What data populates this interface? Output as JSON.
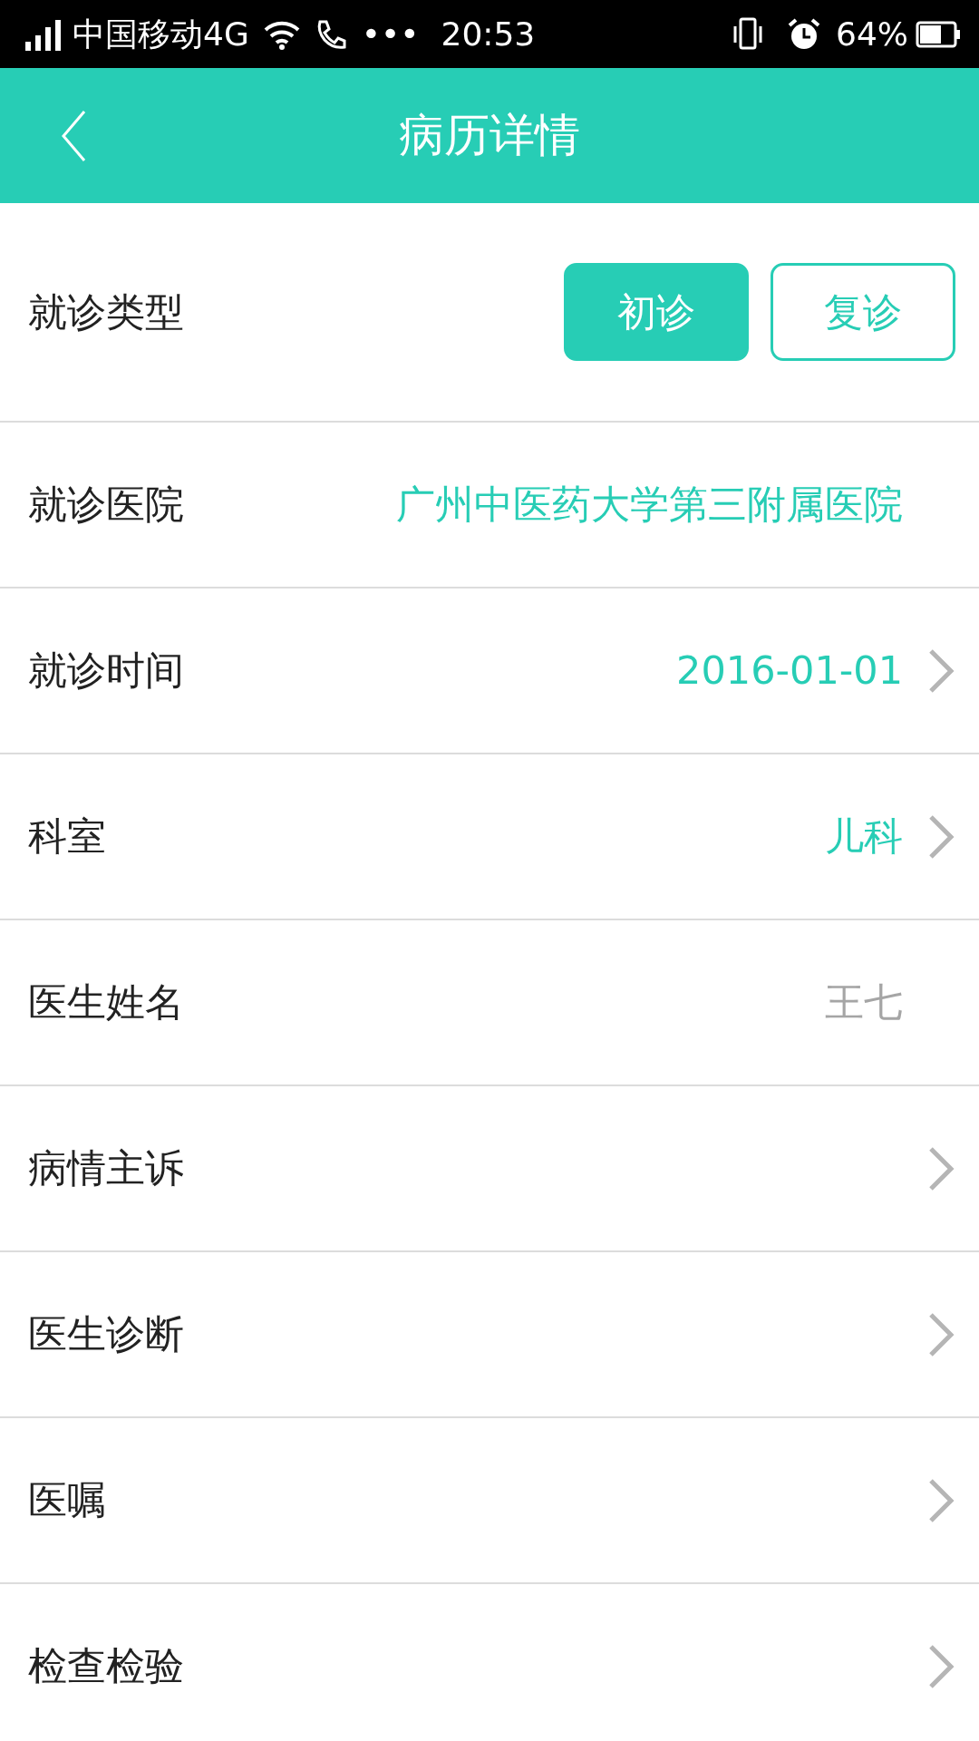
{
  "status_bar": {
    "carrier": "中国移动4G",
    "dots": "•••",
    "time": "20:53",
    "battery": "64%"
  },
  "header": {
    "title": "病历详情"
  },
  "rows": [
    {
      "kind": "toggle",
      "label": "就诊类型",
      "options": [
        {
          "label": "初诊",
          "selected": true
        },
        {
          "label": "复诊",
          "selected": false
        }
      ]
    },
    {
      "kind": "value",
      "label": "就诊医院",
      "value": "广州中医药大学第三附属医院",
      "muted": false,
      "chevron": false
    },
    {
      "kind": "value",
      "label": "就诊时间",
      "value": "2016-01-01",
      "muted": false,
      "chevron": true
    },
    {
      "kind": "value",
      "label": "科室",
      "value": "儿科",
      "muted": false,
      "chevron": true
    },
    {
      "kind": "value",
      "label": "医生姓名",
      "value": "王七",
      "muted": true,
      "chevron": false
    },
    {
      "kind": "value",
      "label": "病情主诉",
      "chevron": true
    },
    {
      "kind": "value",
      "label": "医生诊断",
      "chevron": true
    },
    {
      "kind": "value",
      "label": "医嘱",
      "chevron": true
    },
    {
      "kind": "value",
      "label": "检查检验",
      "chevron": true
    }
  ]
}
